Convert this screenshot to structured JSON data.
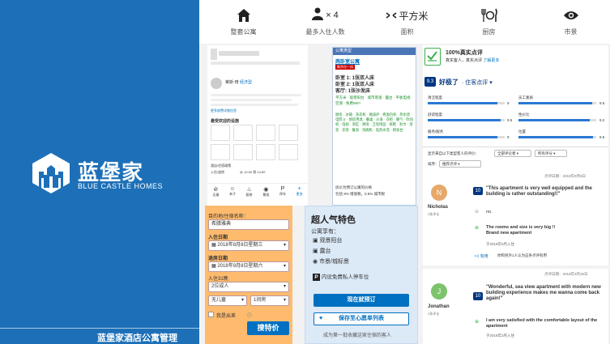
{
  "brand": {
    "name_cn": "蓝堡家",
    "name_en": "BLUE CASTLE HOMES",
    "footer": "蓝堡家酒店公寓管理"
  },
  "colors": {
    "brand_blue": "#1d70b8",
    "booking_blue": "#0071c2",
    "search_orange": "#febb6e",
    "feature_blue": "#dce9f7"
  },
  "features": [
    {
      "icon": "house-icon",
      "label": "整套公寓"
    },
    {
      "icon": "guests-icon",
      "value": "× 4",
      "label": "最多入住人数"
    },
    {
      "icon": "area-icon",
      "value": "平方米",
      "label": "面积"
    },
    {
      "icon": "kitchen-icon",
      "label": "厨房"
    },
    {
      "icon": "eye-icon",
      "label": "市景"
    }
  ],
  "listing": {
    "host_name": "莱斯·琦",
    "host_tag": "经济型",
    "fee_link": "更多收费详细信息",
    "amenities_title": "最受欢迎的设施",
    "checkin_label": "入住/退房",
    "checkin_text": "从 12:00 到 14:00",
    "policies_title": "酒店/住宿政策",
    "bottom_icons": [
      "无烟",
      "亲子",
      "厨房",
      "景观",
      "停车",
      "更多"
    ]
  },
  "apartment": {
    "title": "公寓类型",
    "name": "两卧室公寓",
    "badge": "剩余仅一间",
    "bedrooms": [
      "卧室 1: 1张双人床",
      "卧室 2: 1张双人床",
      "客厅: 1张沙发床"
    ],
    "perks": [
      "平方米",
      "观景阳台",
      "城市景观",
      "露台",
      "平板电视",
      "空调",
      "免费WiFi"
    ],
    "amenities": [
      "厨房",
      "冰箱",
      "洗衣机",
      "微波炉",
      "烤面包机",
      "热水壶",
      "电熨斗",
      "厨房用具",
      "餐桌",
      "沙发",
      "衣柜",
      "暖气",
      "吹风机",
      "电视",
      "浴缸",
      "淋浴",
      "卫浴用品",
      "拖鞋",
      "毛巾",
      "浴室",
      "衣架",
      "餐具",
      "洗碗机",
      "电热水壶",
      "梳妆台"
    ],
    "pricing": "房价为预订公寓的价格",
    "tax": "包括 9% 增值税，0.5% 城市税"
  },
  "review": {
    "title": "100%真实点评",
    "subtitle": "真实客人，真实点评",
    "link": "了解更多",
    "score": "9.3",
    "rating_label": "好极了",
    "rating_sub": "· 住客点评",
    "categories": [
      {
        "name": "清洁程度",
        "score": "9",
        "fill": 0.9
      },
      {
        "name": "舒适程度",
        "score": "9.5",
        "fill": 0.95
      },
      {
        "name": "服务/服务",
        "score": "9",
        "fill": 0.9
      },
      {
        "name": "员工素质",
        "score": "9.5",
        "fill": 0.95
      },
      {
        "name": "性价比",
        "score": "9.2",
        "fill": 0.92
      },
      {
        "name": "位置",
        "score": "9.6",
        "fill": 0.96
      }
    ],
    "filter_label": "显示来自以下类型客人的评价：",
    "filter_all": "全部评论者",
    "filter_lang": "所有评分",
    "sort_label": "排序：",
    "sort_value": "推荐点评",
    "items": [
      {
        "date": "点评日期：2018年9月8日",
        "initial": "N",
        "avatar_color": "#e6a96a",
        "name": "Nicholas",
        "meta": "3条评论",
        "score": "10",
        "quote": "\"This apartment is very well equipped and the building is rather outstanding!!\"",
        "neg": "no.",
        "pos": "The rooms and size is very big !! Brand new apartment",
        "stay": "于2018年5月入住",
        "helpful": "有用",
        "helpful_note": "你和另外1人认为这条点评有用"
      },
      {
        "date": "点评日期：2018年3月26日",
        "initial": "J",
        "avatar_color": "#7cc36b",
        "name": "Jonathan",
        "meta": "2条评论",
        "score": "10",
        "quote": "\"Wonderful, sea view apartment with modern new building experience makes me wanna come back again!\"",
        "pos": "I am very satisfied with the comfortable layout of the apartment",
        "stay": "于2018年3月入住"
      }
    ]
  },
  "search": {
    "dest_label": "目的地/住宿名称：",
    "dest_value": "希腊雅典",
    "checkin_label": "入住日期",
    "checkin_value": "2018年8月8日星期三",
    "checkout_label": "退房日期",
    "checkout_value": "2018年9月8日星期六",
    "nights": "入住31晚",
    "adults": "2位成人",
    "children": "无儿童",
    "rooms": "1间房",
    "work_trip": "我是出差",
    "button": "搜特价"
  },
  "highlights": {
    "title": "超人气特色",
    "sub": "公寓享有：",
    "items": [
      "观景阳台",
      "露台",
      "市景/城标景"
    ],
    "parking": "内设免费私人停车位",
    "book_button": "现在就预订",
    "save_button": "保存至心愿单列表",
    "note": "成为第一批收藏这家住宿的客人"
  }
}
